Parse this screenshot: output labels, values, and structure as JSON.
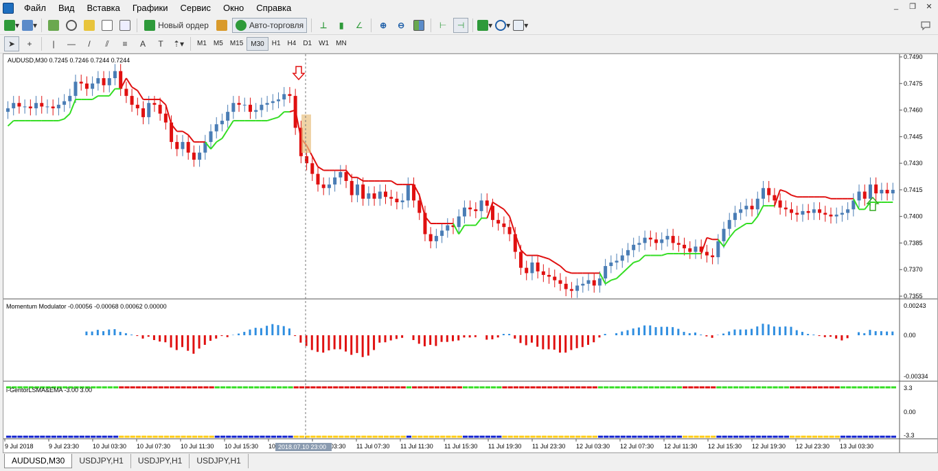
{
  "menu": {
    "items": [
      "Файл",
      "Вид",
      "Вставка",
      "Графики",
      "Сервис",
      "Окно",
      "Справка"
    ]
  },
  "toolbar": {
    "new_order_label": "Новый ордер",
    "autotrading_label": "Авто-торговля",
    "timeframes": [
      "M1",
      "M5",
      "M15",
      "M30",
      "H1",
      "H4",
      "D1",
      "W1",
      "MN"
    ],
    "active_timeframe": "M30"
  },
  "chart": {
    "main_header": "AUDUSD,M30  0.7245 0.7246 0.7244 0.7244",
    "indicator1_header": "Momentum Modulator -0.00056 -0.00068 0.00062 0.00000",
    "indicator2_header": "i-GentorLSMA&EMA -3.00 3.00",
    "price_labels": [
      "0.7490",
      "0.7475",
      "0.7460",
      "0.7445",
      "0.7430",
      "0.7415",
      "0.7400",
      "0.7385",
      "0.7370",
      "0.7355"
    ],
    "ind1_labels": [
      "0.00243",
      "0.00",
      "-0.00334"
    ],
    "ind2_labels": [
      "3.3",
      "0.00",
      "-3.3"
    ],
    "time_labels": [
      "9 Jul 2018",
      "9 Jul 23:30",
      "10 Jul 03:30",
      "10 Jul 07:30",
      "10 Jul 11:30",
      "10 Jul 15:30",
      "10 Jul 19:30",
      "11 Jul 03:30",
      "11 Jul 07:30",
      "11 Jul 11:30",
      "11 Jul 15:30",
      "11 Jul 19:30",
      "11 Jul 23:30",
      "12 Jul 03:30",
      "12 Jul 07:30",
      "12 Jul 11:30",
      "12 Jul 15:30",
      "12 Jul 19:30",
      "12 Jul 23:30",
      "13 Jul 03:30"
    ],
    "crosshair_time": "2018.07.10 23:00",
    "colors": {
      "bull": "#4a7db5",
      "bear": "#e01010",
      "green_line": "#33dd22",
      "red_line": "#e01010",
      "blue_band": "#1020d0",
      "yellow_band": "#ffcc11"
    }
  },
  "chart_data": {
    "type": "candlestick",
    "symbol": "AUDUSD,M30",
    "close": [
      0.7461,
      0.7464,
      0.7462,
      0.7462,
      0.7461,
      0.7464,
      0.7462,
      0.7462,
      0.7461,
      0.7463,
      0.7465,
      0.7468,
      0.7476,
      0.7475,
      0.7472,
      0.7475,
      0.7478,
      0.7474,
      0.7478,
      0.7482,
      0.7472,
      0.7468,
      0.7463,
      0.7461,
      0.7456,
      0.7464,
      0.7463,
      0.7458,
      0.7453,
      0.7442,
      0.7438,
      0.7442,
      0.7436,
      0.7432,
      0.7436,
      0.7442,
      0.7448,
      0.7452,
      0.7454,
      0.7459,
      0.7464,
      0.7463,
      0.7463,
      0.7459,
      0.746,
      0.7463,
      0.7464,
      0.7465,
      0.7466,
      0.7469,
      0.7468,
      0.745,
      0.7434,
      0.743,
      0.7424,
      0.7418,
      0.7416,
      0.7418,
      0.7422,
      0.7425,
      0.742,
      0.7412,
      0.7418,
      0.741,
      0.7413,
      0.741,
      0.7414,
      0.7411,
      0.741,
      0.7408,
      0.7409,
      0.7418,
      0.7409,
      0.7402,
      0.739,
      0.7386,
      0.7389,
      0.7392,
      0.7395,
      0.7394,
      0.74,
      0.7405,
      0.7404,
      0.7403,
      0.7409,
      0.7406,
      0.7398,
      0.7396,
      0.7394,
      0.739,
      0.738,
      0.7371,
      0.7368,
      0.7374,
      0.7369,
      0.7367,
      0.7366,
      0.7364,
      0.7362,
      0.7359,
      0.7358,
      0.7361,
      0.7362,
      0.7364,
      0.7361,
      0.7365,
      0.7372,
      0.7374,
      0.7375,
      0.7378,
      0.7381,
      0.7384,
      0.7385,
      0.7388,
      0.7387,
      0.7385,
      0.7387,
      0.7389,
      0.7385,
      0.7384,
      0.7382,
      0.738,
      0.7383,
      0.738,
      0.7378,
      0.7377,
      0.7386,
      0.7393,
      0.7398,
      0.7402,
      0.7404,
      0.7406,
      0.7404,
      0.741,
      0.7416,
      0.7412,
      0.7409,
      0.7405,
      0.7404,
      0.7402,
      0.7401,
      0.7403,
      0.7402,
      0.7404,
      0.7402,
      0.7401,
      0.74,
      0.7401,
      0.7402,
      0.7404,
      0.7409,
      0.7414,
      0.741,
      0.7418,
      0.7413,
      0.7415,
      0.7413,
      0.7415
    ],
    "ind1_ylim": [
      -0.00334,
      0.00243
    ],
    "ind2_ylim": [
      -3.3,
      3.3
    ],
    "ylim": [
      0.7355,
      0.749
    ]
  }
}
